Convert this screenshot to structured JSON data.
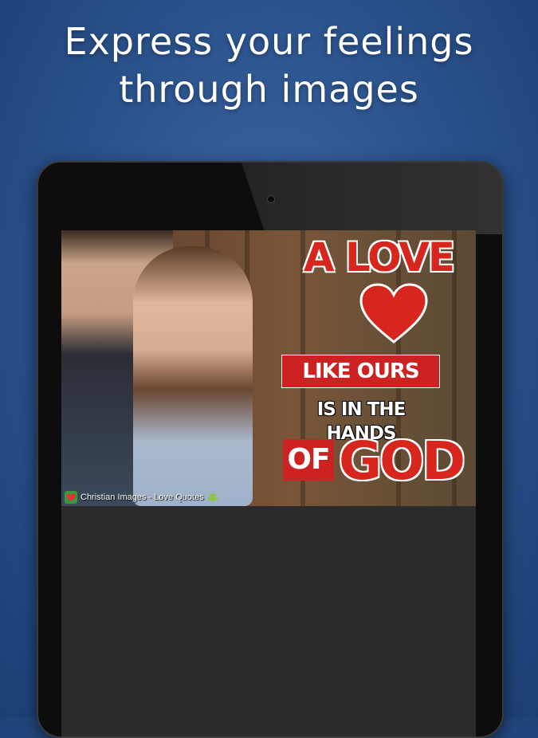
{
  "headline": {
    "line1": "Express your feelings",
    "line2": "through images"
  },
  "colors": {
    "background": "#2d558f",
    "accent_red": "#cc2222",
    "screen_bg": "#2b2b2b"
  },
  "image": {
    "quote": {
      "line1": "A LOVE",
      "line2": "LIKE OURS",
      "line3": "IS IN THE HANDS",
      "line4a": "OF",
      "line4b": "GOD"
    },
    "watermark": {
      "text": "Christian Images - Love Quotes",
      "logo_icon": "heart-icon",
      "platform_icon": "android-icon"
    }
  }
}
